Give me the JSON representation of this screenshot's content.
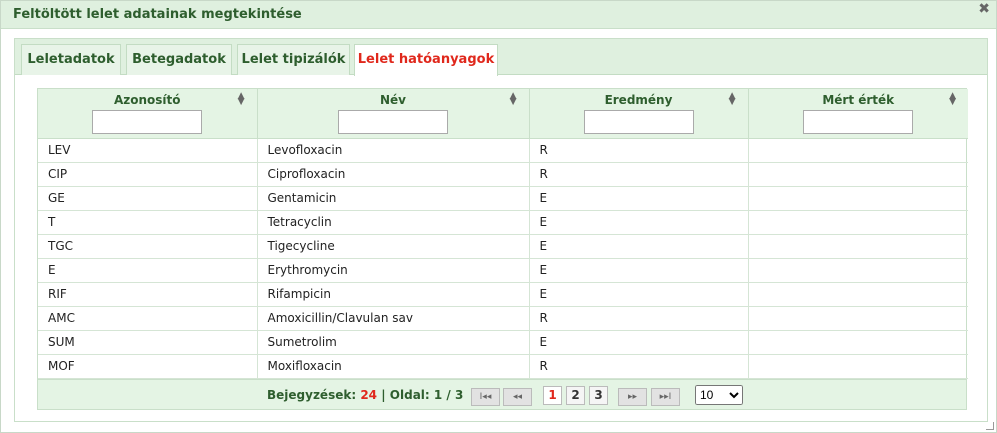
{
  "dialog": {
    "title": "Feltöltött lelet adatainak megtekintése",
    "close_glyph": "✖"
  },
  "tabs": [
    {
      "label": "Leletadatok",
      "active": false
    },
    {
      "label": "Betegadatok",
      "active": false
    },
    {
      "label": "Lelet tipizálók",
      "active": false
    },
    {
      "label": "Lelet hatóanyagok",
      "active": true
    }
  ],
  "grid": {
    "columns": [
      {
        "label": "Azonosító",
        "filter_value": ""
      },
      {
        "label": "Név",
        "filter_value": ""
      },
      {
        "label": "Eredmény",
        "filter_value": ""
      },
      {
        "label": "Mért érték",
        "filter_value": ""
      }
    ],
    "rows": [
      [
        "LEV",
        "Levofloxacin",
        "R",
        ""
      ],
      [
        "CIP",
        "Ciprofloxacin",
        "R",
        ""
      ],
      [
        "GE",
        "Gentamicin",
        "E",
        ""
      ],
      [
        "T",
        "Tetracyclin",
        "E",
        ""
      ],
      [
        "TGC",
        "Tigecycline",
        "E",
        ""
      ],
      [
        "E",
        "Erythromycin",
        "E",
        ""
      ],
      [
        "RIF",
        "Rifampicin",
        "E",
        ""
      ],
      [
        "AMC",
        "Amoxicillin/Clavulan sav",
        "R",
        ""
      ],
      [
        "SUM",
        "Sumetrolim",
        "E",
        ""
      ],
      [
        "MOF",
        "Moxifloxacin",
        "R",
        ""
      ]
    ]
  },
  "pager": {
    "records_label": "Bejegyzések:",
    "records_total": "24",
    "separator": "|",
    "page_label": "Oldal:",
    "page_value": "1 / 3",
    "first_glyph": "I◂◂",
    "prev_glyph": "◂◂",
    "next_glyph": "▸▸",
    "last_glyph": "▸▸I",
    "pages": [
      "1",
      "2",
      "3"
    ],
    "current_page": "1",
    "page_size": "10",
    "page_size_options": [
      "10"
    ]
  },
  "icons": {
    "sort": "sort-icon",
    "close": "close-icon"
  },
  "colors": {
    "header_green": "#dff0df",
    "title_green": "#2e5e2e",
    "active_red": "#e0281c"
  }
}
